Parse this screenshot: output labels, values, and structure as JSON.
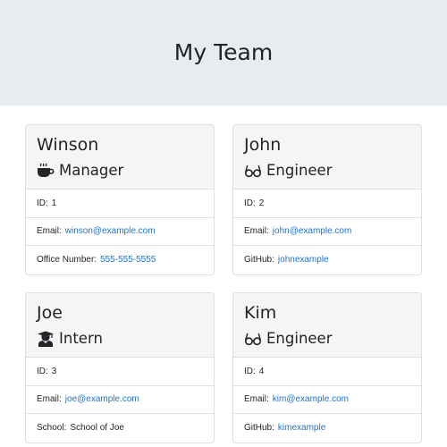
{
  "header": {
    "title": "My Team"
  },
  "employees": [
    {
      "name": "Winson",
      "role": "Manager",
      "role_icon": "coffee-icon",
      "id_label": "ID:",
      "id": "1",
      "email_label": "Email:",
      "email": "winson@example.com",
      "extra_label": "Office Number:",
      "extra": "555-555-5555",
      "extra_is_link": true
    },
    {
      "name": "John",
      "role": "Engineer",
      "role_icon": "glasses-icon",
      "id_label": "ID:",
      "id": "2",
      "email_label": "Email:",
      "email": "john@example.com",
      "extra_label": "GitHub:",
      "extra": "johnexample",
      "extra_is_link": true
    },
    {
      "name": "Joe",
      "role": "Intern",
      "role_icon": "graduate-icon",
      "id_label": "ID:",
      "id": "3",
      "email_label": "Email:",
      "email": "joe@example.com",
      "extra_label": "School:",
      "extra": "School of Joe",
      "extra_is_link": false
    },
    {
      "name": "Kim",
      "role": "Engineer",
      "role_icon": "glasses-icon",
      "id_label": "ID:",
      "id": "4",
      "email_label": "Email:",
      "email": "kim@example.com",
      "extra_label": "GitHub:",
      "extra": "kimexample",
      "extra_is_link": true
    }
  ],
  "colors": {
    "header_bg": "#e9ecef",
    "card_header_bg": "#f5f5f5",
    "link": "#1b73d6"
  }
}
